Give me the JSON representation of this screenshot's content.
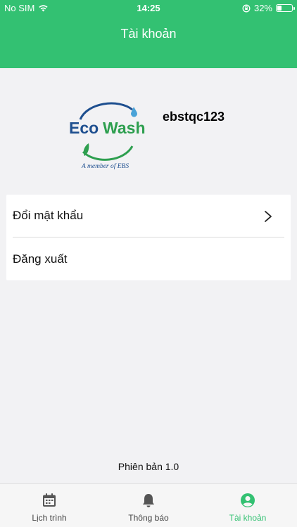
{
  "status_bar": {
    "carrier": "No SIM",
    "time": "14:25",
    "battery": "32%",
    "battery_level": 0.32
  },
  "header": {
    "title": "Tài khoản"
  },
  "profile": {
    "logo_text_eco": "Eco",
    "logo_text_wash": "Wash",
    "logo_tagline": "A member of EBS",
    "username": "ebstqc123"
  },
  "menu": {
    "change_password": "Đổi mật khẩu",
    "logout": "Đăng xuất"
  },
  "footer": {
    "version": "Phiên bản 1.0"
  },
  "tabs": [
    {
      "label": "Lịch trình",
      "icon": "calendar-icon",
      "active": false
    },
    {
      "label": "Thông báo",
      "icon": "bell-icon",
      "active": false
    },
    {
      "label": "Tài khoản",
      "icon": "account-icon",
      "active": true
    }
  ],
  "colors": {
    "brand_green": "#33c172",
    "logo_blue": "#1e4f8f",
    "logo_green": "#2e9f4f"
  }
}
